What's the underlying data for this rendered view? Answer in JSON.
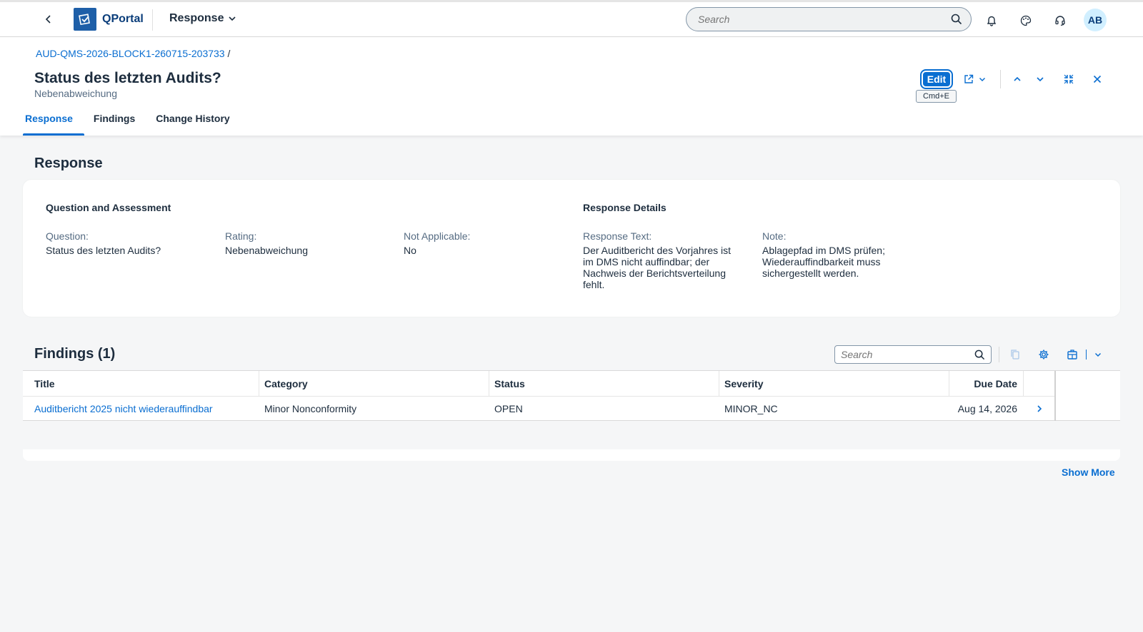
{
  "shell": {
    "product_name": "QPortal",
    "app_menu": "Response",
    "search_placeholder": "Search",
    "avatar_initials": "AB"
  },
  "header": {
    "breadcrumb_link": "AUD-QMS-2026-BLOCK1-260715-203733",
    "breadcrumb_sep": "/",
    "title": "Status des letzten Audits?",
    "subtitle": "Nebenabweichung",
    "edit_label": "Edit",
    "edit_shortcut": "Cmd+E"
  },
  "tabs": [
    {
      "label": "Response",
      "active": true
    },
    {
      "label": "Findings",
      "active": false
    },
    {
      "label": "Change History",
      "active": false
    }
  ],
  "response_section": {
    "title": "Response",
    "group_left_title": "Question and Assessment",
    "group_right_title": "Response Details",
    "fields": {
      "question_label": "Question:",
      "question_value": "Status des letzten Audits?",
      "rating_label": "Rating:",
      "rating_value": "Nebenabweichung",
      "na_label": "Not Applicable:",
      "na_value": "No",
      "response_text_label": "Response Text:",
      "response_text_value": "Der Auditbericht des Vorjahres ist im DMS nicht auffindbar; der Nachweis der Berichtsverteilung fehlt.",
      "note_label": "Note:",
      "note_value": "Ablagepfad im DMS prüfen; Wiederauffindbarkeit muss sichergestellt werden."
    }
  },
  "findings": {
    "title": "Findings (1)",
    "search_placeholder": "Search",
    "columns": [
      "Title",
      "Category",
      "Status",
      "Severity",
      "Due Date"
    ],
    "rows": [
      {
        "title": "Auditbericht 2025 nicht wiederauffindbar",
        "category": "Minor Nonconformity",
        "status": "OPEN",
        "severity": "MINOR_NC",
        "due_date": "Aug 14, 2026"
      }
    ],
    "show_more": "Show More"
  },
  "colors": {
    "accent": "#0a6ed1",
    "brand": "#1e5fa8",
    "text": "#1d2d3e",
    "label": "#556b82",
    "background": "#f5f6f7"
  },
  "icons": {
    "back": "chevron-left-icon",
    "logo": "qportal-logo-icon",
    "app_menu": "chevron-down-icon",
    "search": "search-icon",
    "notifications": "bell-icon",
    "theme": "palette-icon",
    "support": "headset-icon",
    "share": "share-icon",
    "prev": "chevron-up-icon",
    "next": "chevron-down-icon",
    "fullscreen": "exit-fullscreen-icon",
    "close": "close-icon",
    "copy": "copy-icon",
    "settings": "gear-icon",
    "export": "export-icon",
    "row_nav": "chevron-right-icon"
  }
}
